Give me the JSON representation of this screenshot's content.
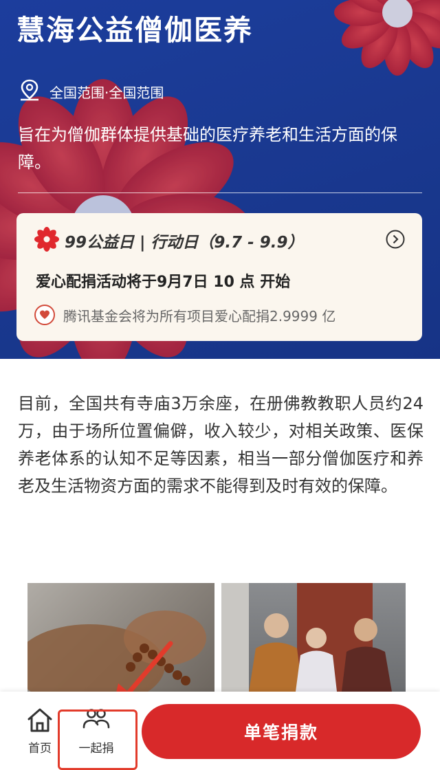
{
  "hero": {
    "title": "慧海公益僧伽医养",
    "location": "全国范围·全国范围",
    "description": "旨在为僧伽群体提供基础的医疗养老和生活方面的保障。"
  },
  "event": {
    "title": "99公益日 | 行动日（9.7 - 9.9）",
    "match_notice": "爱心配捐活动将于9月7日 10 点 开始",
    "foundation_notice": "腾讯基金会将为所有项目爱心配捐2.9999 亿"
  },
  "content": {
    "paragraph": "目前，全国共有寺庙3万余座，在册佛教教职人员约24万，由于场所位置偏僻，收入较少，对相关政策、医保养老体系的认知不足等因素，相当一部分僧伽医疗和养老及生活物资方面的需求不能得到及时有效的保障。"
  },
  "nav": {
    "home_label": "首页",
    "together_label": "一起捐",
    "donate_label": "单笔捐款"
  },
  "colors": {
    "hero_bg": "#1a3a92",
    "accent_red": "#d8292a",
    "card_bg": "#fbf6ee"
  }
}
